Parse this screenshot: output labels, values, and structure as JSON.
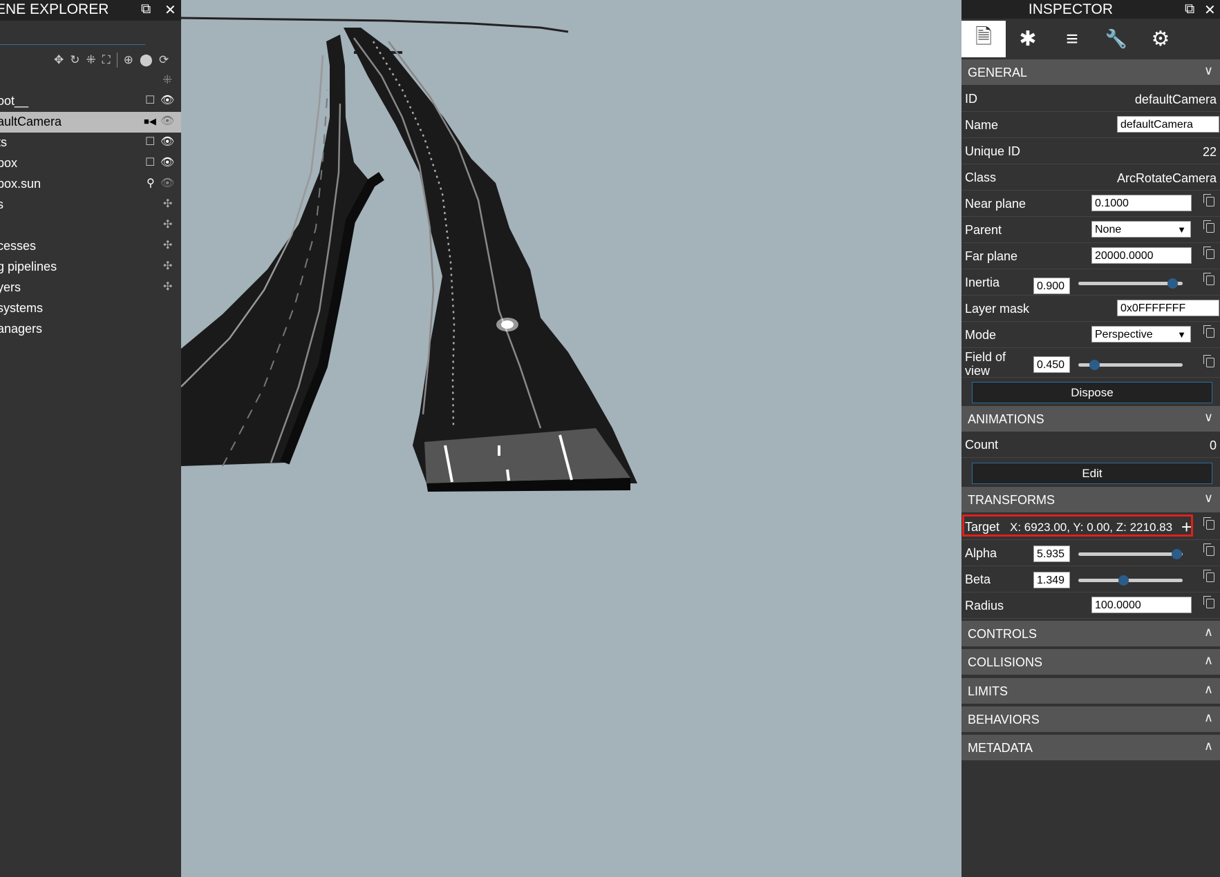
{
  "explorer": {
    "title": "ENE EXPLORER",
    "undock_icon": "⧉",
    "close_icon": "✕",
    "toolbar": [
      "✥",
      "↻",
      "⁜",
      "⛶",
      "⊕",
      "⬤",
      "⟳"
    ],
    "collapse_icon": "⁜",
    "items": [
      {
        "label": "oot__",
        "icons": [
          "☐",
          "👁"
        ]
      },
      {
        "label": "aultCamera",
        "icons": [
          "■◀",
          "👁"
        ],
        "selected": true
      },
      {
        "label": "ts",
        "icons": [
          "☐",
          "👁"
        ]
      },
      {
        "label": "box",
        "icons": [
          "☐",
          "👁"
        ]
      },
      {
        "label": "box.sun",
        "icons": [
          "⚲",
          "👁"
        ]
      },
      {
        "label": "s",
        "icons": [
          "✣"
        ]
      },
      {
        "label": "",
        "icons": [
          "✣"
        ]
      },
      {
        "label": "cesses",
        "icons": [
          "✣"
        ]
      },
      {
        "label": "g pipelines",
        "icons": [
          "✣"
        ]
      },
      {
        "label": "yers",
        "icons": [
          "✣"
        ]
      },
      {
        "label": "systems",
        "icons": []
      },
      {
        "label": "anagers",
        "icons": []
      }
    ]
  },
  "inspector": {
    "title": "INSPECTOR",
    "undock_icon": "⧉",
    "close_icon": "✕",
    "tabs": [
      {
        "icon": "file-icon",
        "glyph": "🗎"
      },
      {
        "icon": "bug-icon",
        "glyph": "✱"
      },
      {
        "icon": "chart-icon",
        "glyph": "≡"
      },
      {
        "icon": "wrench-icon",
        "glyph": "🔧"
      },
      {
        "icon": "gear-icon",
        "glyph": "⚙"
      }
    ],
    "sections": {
      "general": "GENERAL",
      "animations": "ANIMATIONS",
      "transforms": "TRANSFORMS",
      "controls": "CONTROLS",
      "collisions": "COLLISIONS",
      "limits": "LIMITS",
      "behaviors": "BEHAVIORS",
      "metadata": "METADATA"
    },
    "chevron_down": "∨",
    "chevron_up": "∧",
    "general": {
      "id_label": "ID",
      "id_value": "defaultCamera",
      "name_label": "Name",
      "name_value": "defaultCamera",
      "uid_label": "Unique ID",
      "uid_value": "22",
      "class_label": "Class",
      "class_value": "ArcRotateCamera",
      "near_label": "Near plane",
      "near_value": "0.1000",
      "parent_label": "Parent",
      "parent_value": "None",
      "far_label": "Far plane",
      "far_value": "20000.0000",
      "inertia_label": "Inertia",
      "inertia_value": "0.900",
      "inertia_level": 0.9,
      "layer_label": "Layer mask",
      "layer_value": "0x0FFFFFFF",
      "mode_label": "Mode",
      "mode_value": "Perspective",
      "fov_label_1": "Field of",
      "fov_label_2": "view",
      "fov_value": "0.450",
      "fov_level": 0.15,
      "dispose_label": "Dispose"
    },
    "animations": {
      "count_label": "Count",
      "count_value": "0",
      "edit_label": "Edit"
    },
    "transforms": {
      "target_label": "Target",
      "target_value": "X: 6923.00, Y: 0.00, Z: 2210.83",
      "target_plus": "+",
      "alpha_label": "Alpha",
      "alpha_value": "5.935",
      "alpha_level": 0.94,
      "beta_label": "Beta",
      "beta_value": "1.349",
      "beta_level": 0.43,
      "radius_label": "Radius",
      "radius_value": "100.0000"
    }
  },
  "colors": {
    "panel_bg": "#333333",
    "section_bg": "#555555",
    "viewport_bg": "#a4b2ba",
    "accent": "#2a5d8a",
    "highlight": "#e0201c"
  }
}
